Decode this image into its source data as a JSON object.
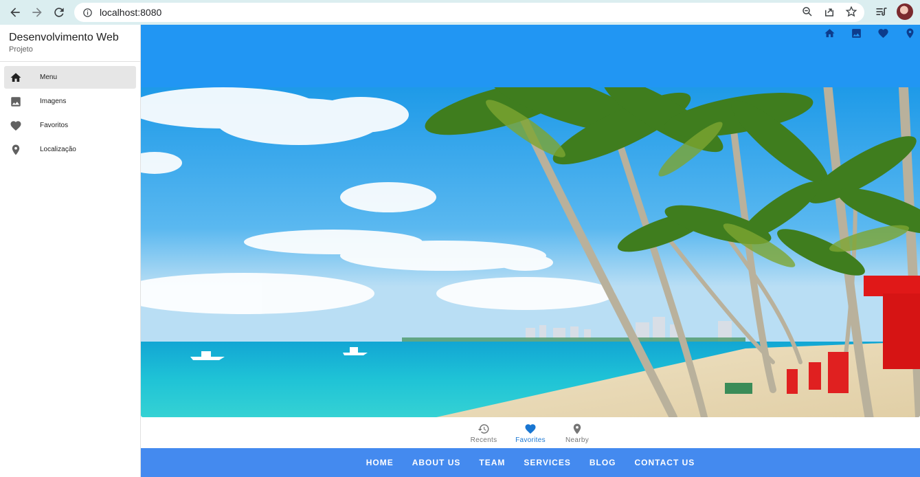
{
  "browser": {
    "url": "localhost:8080"
  },
  "sidebar": {
    "title": "Desenvolvimento Web",
    "subtitle": "Projeto",
    "items": [
      {
        "label": "Menu",
        "icon": "home-icon"
      },
      {
        "label": "Imagens",
        "icon": "image-icon"
      },
      {
        "label": "Favoritos",
        "icon": "heart-icon"
      },
      {
        "label": "Localização",
        "icon": "location-icon"
      }
    ]
  },
  "colors": {
    "primary": "#2196f3",
    "footer": "#448aef",
    "active_nav": "#1976d2"
  },
  "top_icons": [
    "home-icon",
    "image-icon",
    "heart-icon",
    "location-icon"
  ],
  "bottom_nav": {
    "items": [
      {
        "label": "Recents",
        "icon": "history-icon"
      },
      {
        "label": "Favorites",
        "icon": "heart-icon"
      },
      {
        "label": "Nearby",
        "icon": "location-icon"
      }
    ]
  },
  "footer": {
    "links": [
      "HOME",
      "ABOUT US",
      "TEAM",
      "SERVICES",
      "BLOG",
      "CONTACT US"
    ]
  }
}
